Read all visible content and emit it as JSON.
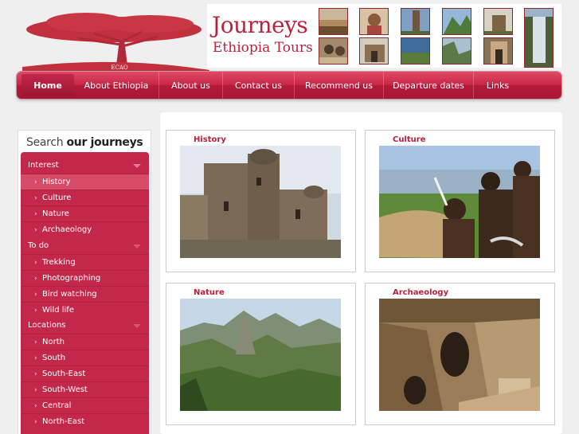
{
  "brand": {
    "line1": "Journeys",
    "line2": "Ethiopia Tours",
    "tree_caption": "ECAO"
  },
  "header_thumbnails": [
    "landscape-icon",
    "person-icon",
    "obelisk-icon",
    "mountain-icon",
    "castle-icon",
    "waterfall-icon",
    "market-icon",
    "ruins-icon",
    "valley-icon",
    "cliff-icon",
    "interior-icon"
  ],
  "nav": {
    "items": [
      "Home",
      "About Ethiopia",
      "About us",
      "Contact us",
      "Recommend us",
      "Departure dates",
      "Links"
    ],
    "active": "Home"
  },
  "sidebar": {
    "title_light": "Search ",
    "title_bold": "our journeys",
    "sections": [
      {
        "label": "Interest",
        "items": [
          "History",
          "Culture",
          "Nature",
          "Archaeology"
        ]
      },
      {
        "label": "To do",
        "items": [
          "Trekking",
          "Photographing",
          "Bird watching",
          "Wild life"
        ]
      },
      {
        "label": "Locations",
        "items": [
          "North",
          "South",
          "South-East",
          "South-West",
          "Central",
          "North-East"
        ]
      }
    ],
    "highlighted_item": "History"
  },
  "cards": [
    {
      "title": "History"
    },
    {
      "title": "Culture"
    },
    {
      "title": "Nature"
    },
    {
      "title": "Archaeology"
    }
  ],
  "colors": {
    "brand_red": "#b8233d",
    "nav_red": "#c92647",
    "sidebar_red": "#c3284a",
    "background": "#efefef"
  }
}
